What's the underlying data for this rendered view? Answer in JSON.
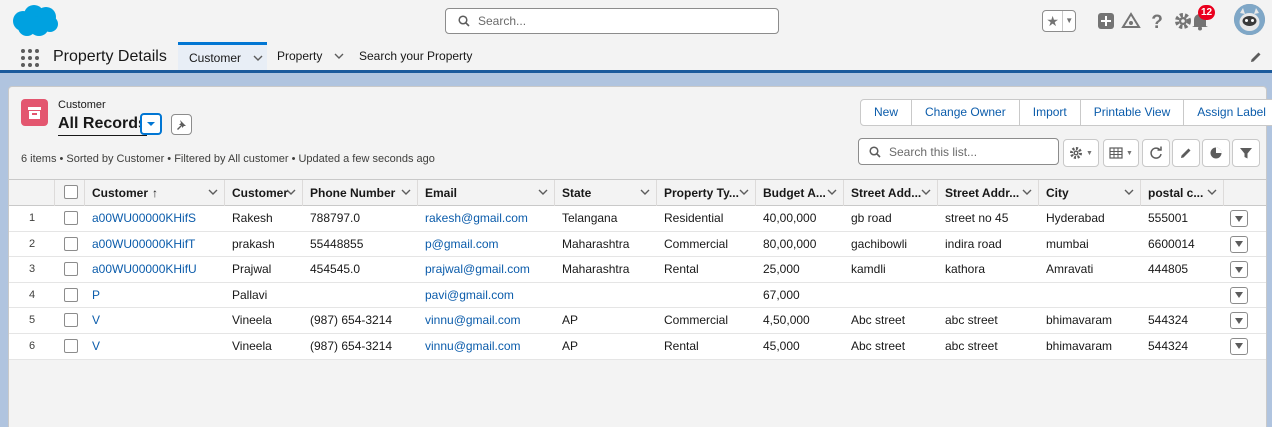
{
  "header": {
    "search_placeholder": "Search...",
    "notification_count": "12"
  },
  "nav": {
    "app_name": "Property Details",
    "tabs": [
      {
        "label": "Customer",
        "active": true
      },
      {
        "label": "Property",
        "active": false
      },
      {
        "label": "Search your Property",
        "active": false
      }
    ]
  },
  "list_view": {
    "object_label": "Customer",
    "title": "All Records",
    "info": "6 items • Sorted by Customer • Filtered by All customer • Updated a few seconds ago",
    "buttons": [
      "New",
      "Change Owner",
      "Import",
      "Printable View",
      "Assign Label"
    ],
    "search_placeholder": "Search this list..."
  },
  "table": {
    "columns": [
      "Customer",
      "Customer",
      "Phone Number",
      "Email",
      "State",
      "Property Ty...",
      "Budget A...",
      "Street Add...",
      "Street Addr...",
      "City",
      "postal c..."
    ],
    "sort_indicator": "↑",
    "rows": [
      {
        "num": "1",
        "name": "a00WU00000KHifS",
        "customer": "Rakesh",
        "phone": "788797.0",
        "email": "rakesh@gmail.com",
        "state": "Telangana",
        "type": "Residential",
        "budget": "40,00,000",
        "street1": "gb road",
        "street2": "street no 45",
        "city": "Hyderabad",
        "postal": "555001"
      },
      {
        "num": "2",
        "name": "a00WU00000KHifT",
        "customer": "prakash",
        "phone": "55448855",
        "email": "p@gmail.com",
        "state": "Maharashtra",
        "type": "Commercial",
        "budget": "80,00,000",
        "street1": "gachibowli",
        "street2": "indira road",
        "city": "mumbai",
        "postal": "6600014"
      },
      {
        "num": "3",
        "name": "a00WU00000KHifU",
        "customer": "Prajwal",
        "phone": "454545.0",
        "email": "prajwal@gmail.com",
        "state": "Maharashtra",
        "type": "Rental",
        "budget": "25,000",
        "street1": "kamdli",
        "street2": "kathora",
        "city": "Amravati",
        "postal": "444805"
      },
      {
        "num": "4",
        "name": "P",
        "customer": "Pallavi",
        "phone": "",
        "email": "pavi@gmail.com",
        "state": "",
        "type": "",
        "budget": "67,000",
        "street1": "",
        "street2": "",
        "city": "",
        "postal": ""
      },
      {
        "num": "5",
        "name": "V",
        "customer": "Vineela",
        "phone": "(987) 654-3214",
        "email": "vinnu@gmail.com",
        "state": "AP",
        "type": "Commercial",
        "budget": "4,50,000",
        "street1": "Abc street",
        "street2": "abc street",
        "city": "bhimavaram",
        "postal": "544324"
      },
      {
        "num": "6",
        "name": "V",
        "customer": "Vineela",
        "phone": "(987) 654-3214",
        "email": "vinnu@gmail.com",
        "state": "AP",
        "type": "Rental",
        "budget": "45,000",
        "street1": "Abc street",
        "street2": "abc street",
        "city": "bhimavaram",
        "postal": "544324"
      }
    ]
  }
}
